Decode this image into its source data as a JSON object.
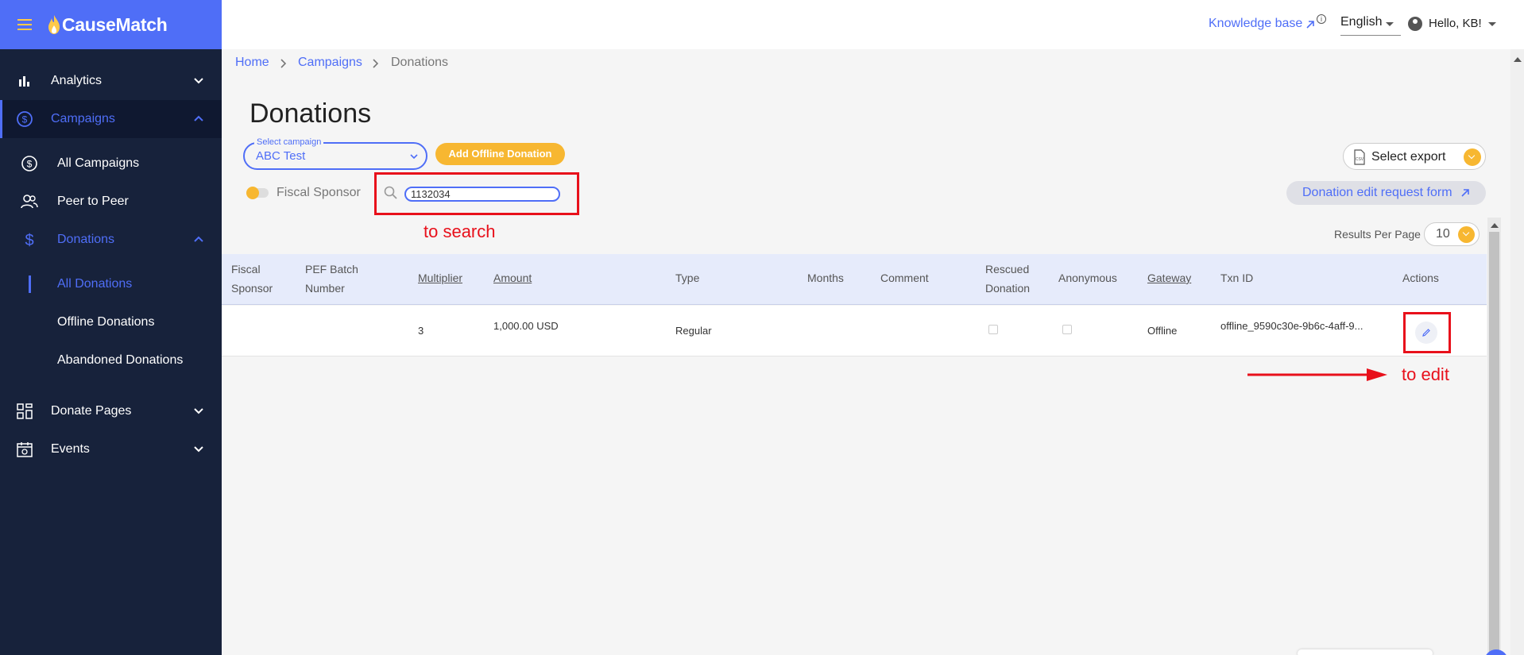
{
  "brand": {
    "name": "CauseMatch"
  },
  "sidebar": {
    "analytics": "Analytics",
    "campaigns": "Campaigns",
    "all_campaigns": "All Campaigns",
    "peer_to_peer": "Peer to Peer",
    "donations": "Donations",
    "all_donations": "All Donations",
    "offline_donations": "Offline Donations",
    "abandoned_donations": "Abandoned Donations",
    "donate_pages": "Donate Pages",
    "events": "Events"
  },
  "header": {
    "knowledge_base": "Knowledge base",
    "language": "English",
    "greeting": "Hello, KB!"
  },
  "breadcrumb": {
    "home": "Home",
    "campaigns": "Campaigns",
    "current": "Donations"
  },
  "page": {
    "title": "Donations"
  },
  "filters": {
    "campaign_label": "Select campaign",
    "campaign_value": "ABC Test",
    "add_offline": "Add Offline Donation",
    "fiscal_sponsor": "Fiscal Sponsor",
    "search_value": "1132034",
    "select_export": "Select export",
    "edit_request_form": "Donation edit request form",
    "results_per_page_label": "Results Per Page",
    "results_per_page_value": "10"
  },
  "annotations": {
    "search": "to search",
    "edit": "to edit"
  },
  "table": {
    "headers": {
      "fiscal_sponsor_1": "Fiscal",
      "fiscal_sponsor_2": "Sponsor",
      "pef_1": "PEF Batch",
      "pef_2": "Number",
      "multiplier": "Multiplier",
      "amount": "Amount",
      "type": "Type",
      "months": "Months",
      "comment": "Comment",
      "rescued_1": "Rescued",
      "rescued_2": "Donation",
      "anonymous": "Anonymous",
      "gateway": "Gateway",
      "txn_id": "Txn ID",
      "actions": "Actions"
    },
    "rows": [
      {
        "multiplier": "3",
        "amount": "1,000.00 USD",
        "type": "Regular",
        "gateway": "Offline",
        "txn_id": "offline_9590c30e-9b6c-4aff-9..."
      }
    ]
  },
  "colors": {
    "accent": "#4f6ef7",
    "sidebar": "#17223b",
    "yellow": "#f7b731",
    "annotation": "#e8101b"
  }
}
